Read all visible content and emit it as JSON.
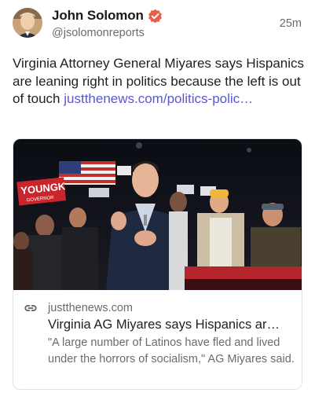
{
  "author": {
    "display_name": "John Solomon",
    "handle": "@jsolomonreports",
    "verified": true,
    "avatar_icon": "avatar-photo"
  },
  "post": {
    "timestamp": "25m",
    "text": "Virginia Attorney General Miyares says Hispanics are leaning right in politics because the left is out of touch",
    "link_text": "justthenews.com/politics-polic…"
  },
  "card": {
    "domain": "justthenews.com",
    "title": "Virginia AG Miyares says Hispanics ar…",
    "description": "\"A large number of Latinos have fled and lived under the horrors of socialism,\" AG Miyares said.",
    "image_sign_text": "YOUNGK",
    "image_sign_subtext": "GOVERNOR"
  },
  "colors": {
    "accent_link": "#5b57d1",
    "verified_badge": "#e8604c",
    "muted_text": "#6b6b6b"
  }
}
